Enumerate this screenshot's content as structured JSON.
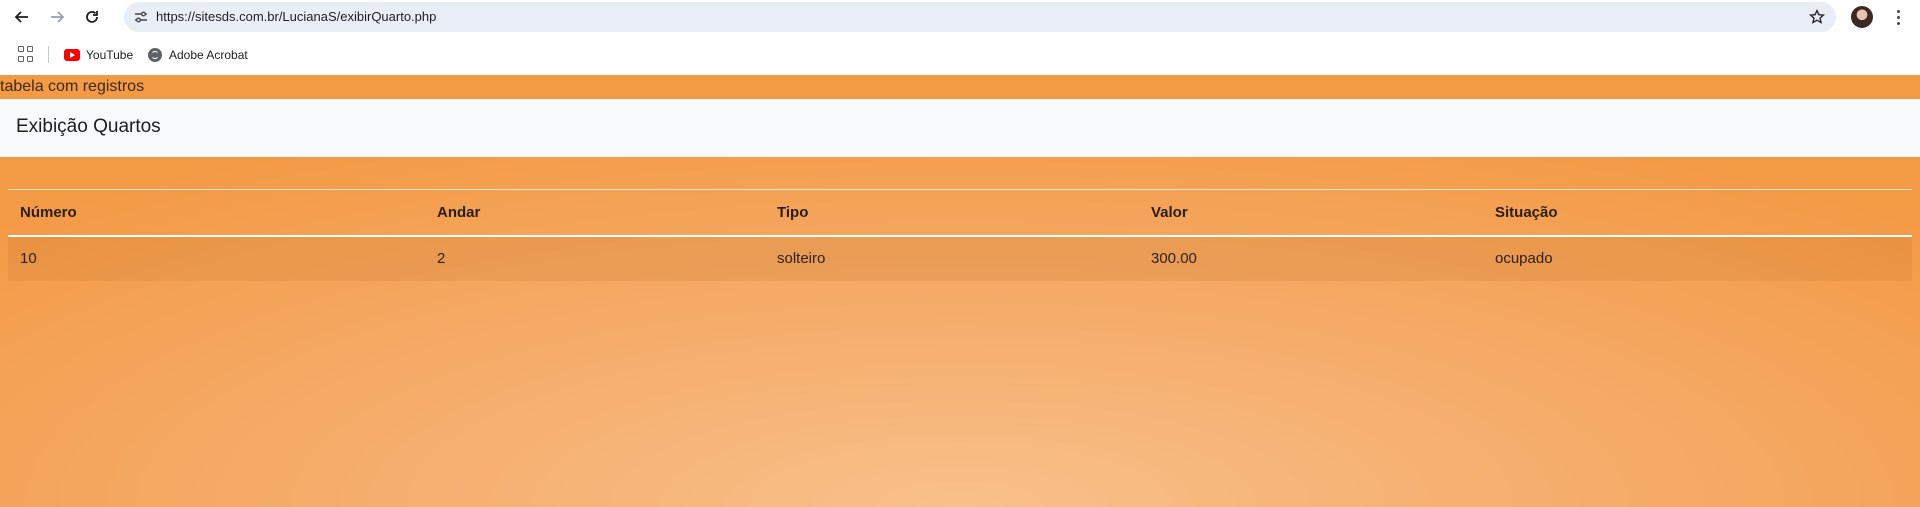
{
  "browser": {
    "url": "https://sitesds.com.br/LucianaS/exibirQuarto.php",
    "bookmarks": [
      {
        "label": "YouTube",
        "icon": "youtube-icon"
      },
      {
        "label": "Adobe Acrobat",
        "icon": "globe-icon"
      }
    ]
  },
  "page": {
    "caption": "tabela com registros",
    "brand": "Exibição Quartos",
    "table": {
      "headers": [
        "Número",
        "Andar",
        "Tipo",
        "Valor",
        "Situação"
      ],
      "rows": [
        [
          "10",
          "2",
          "solteiro",
          "300.00",
          "ocupado"
        ]
      ]
    }
  },
  "colors": {
    "accent": "#f39a45",
    "navbar": "#f8f9fa"
  }
}
